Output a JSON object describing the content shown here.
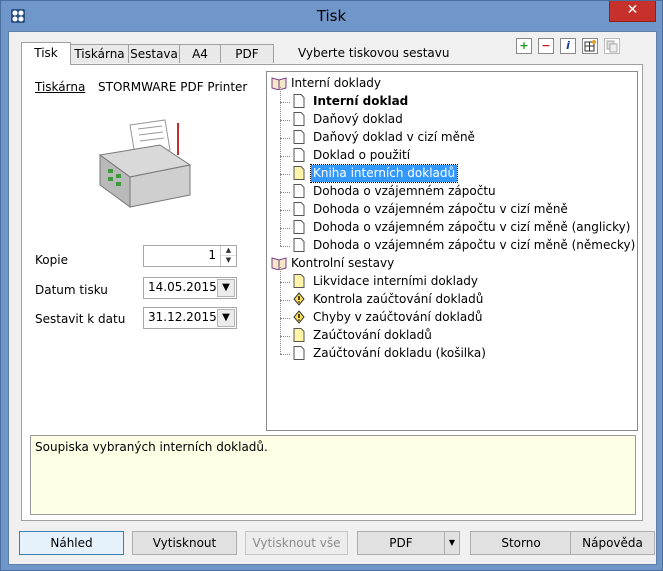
{
  "window": {
    "title": "Tisk",
    "close_label": "✕"
  },
  "tabs": [
    {
      "label": "Tisk",
      "active": true
    },
    {
      "label": "Tiskárna",
      "active": false
    },
    {
      "label": "Sestava",
      "active": false
    },
    {
      "label": "A4",
      "active": false
    },
    {
      "label": "PDF",
      "active": false
    }
  ],
  "tab_caption": "Vyberte tiskovou sestavu",
  "toolbar": {
    "icons": [
      "add-icon",
      "remove-icon",
      "info-icon",
      "grid-icon",
      "copy-icon"
    ],
    "add_glyph": "+",
    "remove_glyph": "−",
    "info_glyph": "i"
  },
  "left": {
    "printer_label": "Tiskárna",
    "printer_name": "STORMWARE PDF Printer",
    "kopie_label": "Kopie",
    "kopie_value": "1",
    "datum_tisku_label": "Datum tisku",
    "datum_tisku_value": "14.05.2015",
    "sestavit_label": "Sestavit k datu",
    "sestavit_value": "31.12.2015"
  },
  "tree": {
    "groups": [
      {
        "label": "Interní doklady",
        "items": [
          {
            "label": "Interní doklad",
            "bold": true,
            "icon": "document-icon"
          },
          {
            "label": "Daňový doklad",
            "icon": "document-icon"
          },
          {
            "label": "Daňový doklad v cizí měně",
            "icon": "document-icon"
          },
          {
            "label": "Doklad o použití",
            "icon": "document-icon"
          },
          {
            "label": "Kniha interních dokladů",
            "selected": true,
            "icon": "yellow-document-icon"
          },
          {
            "label": "Dohoda o vzájemném zápočtu",
            "icon": "document-icon"
          },
          {
            "label": "Dohoda o vzájemném zápočtu v cizí měně",
            "icon": "document-icon"
          },
          {
            "label": "Dohoda o vzájemném zápočtu v cizí měně (anglicky)",
            "icon": "document-icon"
          },
          {
            "label": "Dohoda o vzájemném zápočtu v cizí měně (německy)",
            "icon": "document-icon"
          }
        ]
      },
      {
        "label": "Kontrolní sestavy",
        "items": [
          {
            "label": "Likvidace interními doklady",
            "icon": "yellow-document-icon"
          },
          {
            "label": "Kontrola zaúčtování dokladů",
            "icon": "warning-icon"
          },
          {
            "label": "Chyby v zaúčtování dokladů",
            "icon": "warning-icon"
          },
          {
            "label": "Zaúčtování dokladů",
            "icon": "yellow-document-icon"
          },
          {
            "label": "Zaúčtování dokladu (košilka)",
            "icon": "document-icon"
          }
        ]
      }
    ]
  },
  "description": "Soupiska vybraných interních dokladů.",
  "buttons": {
    "nahled": "Náhled",
    "vytisknout": "Vytisknout",
    "vytisknout_vse": "Vytisknout vše",
    "pdf": "PDF",
    "storno": "Storno",
    "napoveda": "Nápověda"
  },
  "colors": {
    "selection": "#3399ff",
    "description_bg": "#ffffe6",
    "close": "#c7312c"
  }
}
